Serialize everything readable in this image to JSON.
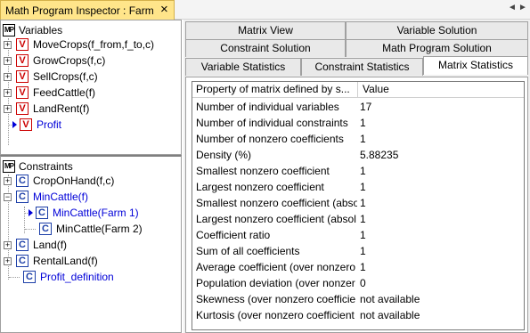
{
  "window": {
    "title": "Math Program Inspector : Farm",
    "close_glyph": "×",
    "ctl_left": "◄",
    "ctl_right": "►"
  },
  "variables_pane": {
    "header": "Variables",
    "items": [
      {
        "label": "MoveCrops(f_from,f_to,c)",
        "expander": "+"
      },
      {
        "label": "GrowCrops(f,c)",
        "expander": "+"
      },
      {
        "label": "SellCrops(f,c)",
        "expander": "+"
      },
      {
        "label": "FeedCattle(f)",
        "expander": "+"
      },
      {
        "label": "LandRent(f)",
        "expander": "+"
      },
      {
        "label": "Profit",
        "expander": ""
      }
    ]
  },
  "constraints_pane": {
    "header": "Constraints",
    "items": [
      {
        "label": "CropOnHand(f,c)",
        "expander": "+"
      },
      {
        "label": "MinCattle(f)",
        "expander": "−"
      },
      {
        "label": "MinCattle(Farm 1)",
        "expander": ""
      },
      {
        "label": "MinCattle(Farm 2)",
        "expander": ""
      },
      {
        "label": "Land(f)",
        "expander": "+"
      },
      {
        "label": "RentalLand(f)",
        "expander": "+"
      },
      {
        "label": "Profit_definition",
        "expander": ""
      }
    ]
  },
  "tabs": {
    "row1": [
      "Matrix View",
      "Variable Solution"
    ],
    "row2": [
      "Constraint Solution",
      "Math Program Solution"
    ],
    "row3": [
      "Variable Statistics",
      "Constraint Statistics",
      "Matrix Statistics"
    ]
  },
  "grid": {
    "col1_header": "Property of matrix defined by s...",
    "col2_header": "Value",
    "rows": [
      {
        "property": "Number of individual variables",
        "value": "17"
      },
      {
        "property": "Number of individual constraints",
        "value": "1"
      },
      {
        "property": "Number of nonzero coefficients",
        "value": "1"
      },
      {
        "property": "Density (%)",
        "value": "5.88235"
      },
      {
        "property": "Smallest nonzero coefficient",
        "value": "1"
      },
      {
        "property": "Largest nonzero coefficient",
        "value": "1"
      },
      {
        "property": "Smallest nonzero coefficient (abso",
        "value": "1"
      },
      {
        "property": "Largest nonzero coefficient (absol",
        "value": "1"
      },
      {
        "property": "Coefficient ratio",
        "value": "1"
      },
      {
        "property": "Sum of all coefficients",
        "value": "1"
      },
      {
        "property": "Average coefficient (over nonzero",
        "value": "1"
      },
      {
        "property": "Population deviation (over nonzer",
        "value": "0"
      },
      {
        "property": "Skewness (over nonzero coefficie",
        "value": "not available"
      },
      {
        "property": "Kurtosis (over nonzero coefficient",
        "value": "not available"
      }
    ]
  },
  "icons": {
    "mp": "MP",
    "variable": "V",
    "constraint": "C"
  }
}
